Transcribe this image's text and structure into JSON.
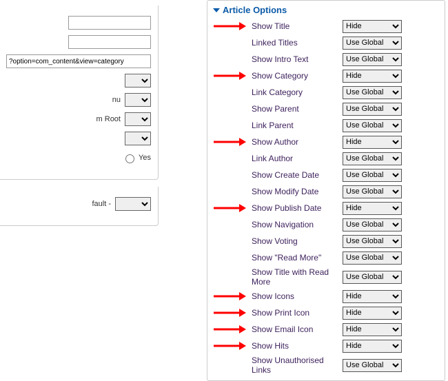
{
  "left": {
    "url_value": "?option=com_content&view=category",
    "menu_label": "nu",
    "root_label": "m Root",
    "default_label": "fault -",
    "yes_label": "Yes"
  },
  "panel": {
    "title": "Article Options"
  },
  "options": [
    {
      "label": "Show Title",
      "value": "Hide",
      "arrow": true
    },
    {
      "label": "Linked Titles",
      "value": "Use Global",
      "arrow": false
    },
    {
      "label": "Show Intro Text",
      "value": "Use Global",
      "arrow": false
    },
    {
      "label": "Show Category",
      "value": "Hide",
      "arrow": true
    },
    {
      "label": "Link Category",
      "value": "Use Global",
      "arrow": false
    },
    {
      "label": "Show Parent",
      "value": "Use Global",
      "arrow": false
    },
    {
      "label": "Link Parent",
      "value": "Use Global",
      "arrow": false
    },
    {
      "label": "Show Author",
      "value": "Hide",
      "arrow": true
    },
    {
      "label": "Link Author",
      "value": "Use Global",
      "arrow": false
    },
    {
      "label": "Show Create Date",
      "value": "Use Global",
      "arrow": false
    },
    {
      "label": "Show Modify Date",
      "value": "Use Global",
      "arrow": false
    },
    {
      "label": "Show Publish Date",
      "value": "Hide",
      "arrow": true
    },
    {
      "label": "Show Navigation",
      "value": "Use Global",
      "arrow": false
    },
    {
      "label": "Show Voting",
      "value": "Use Global",
      "arrow": false
    },
    {
      "label": "Show \"Read More\"",
      "value": "Use Global",
      "arrow": false
    },
    {
      "label": "Show Title with Read More",
      "value": "Use Global",
      "arrow": false
    },
    {
      "label": "Show Icons",
      "value": "Hide",
      "arrow": true
    },
    {
      "label": "Show Print Icon",
      "value": "Hide",
      "arrow": true
    },
    {
      "label": "Show Email Icon",
      "value": "Hide",
      "arrow": true
    },
    {
      "label": "Show Hits",
      "value": "Hide",
      "arrow": true
    },
    {
      "label": "Show Unauthorised Links",
      "value": "Use Global",
      "arrow": false
    }
  ]
}
